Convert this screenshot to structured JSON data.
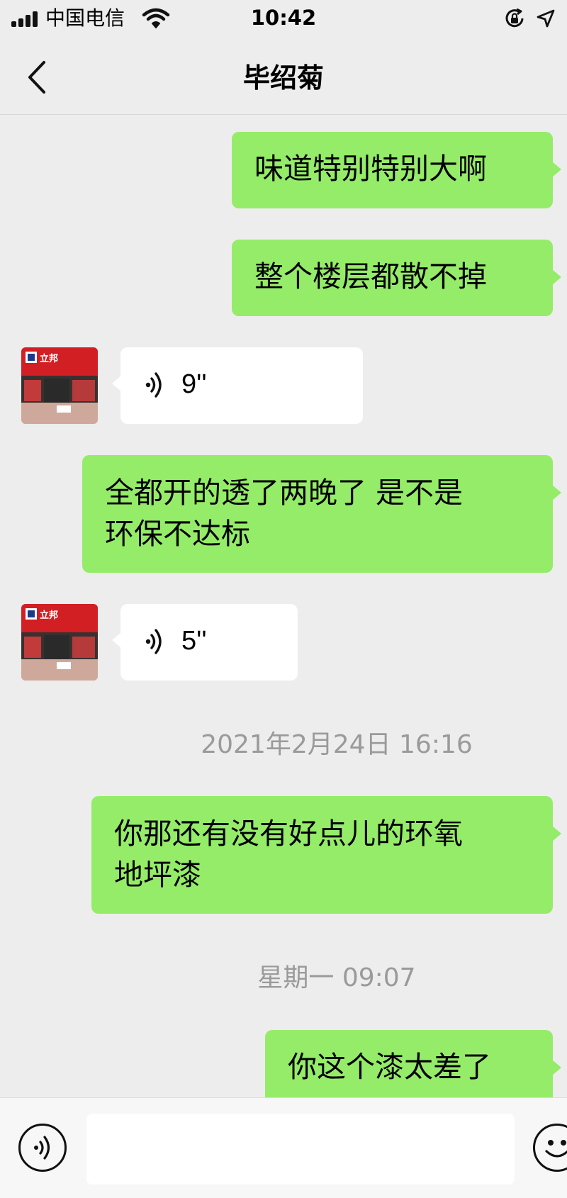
{
  "status_bar": {
    "carrier": "中国电信",
    "time": "10:42"
  },
  "header": {
    "title": "毕绍菊"
  },
  "messages": [
    {
      "direction": "out",
      "type": "text",
      "text": "味道特别特别大啊"
    },
    {
      "direction": "out",
      "type": "text",
      "text": "整个楼层都散不掉"
    },
    {
      "direction": "in",
      "type": "voice",
      "duration": "9''",
      "avatar_sign": "立邦"
    },
    {
      "direction": "out",
      "type": "text",
      "text": "全都开的透了两晚了 是不是\n环保不达标"
    },
    {
      "direction": "in",
      "type": "voice",
      "duration": "5''",
      "avatar_sign": "立邦"
    },
    {
      "type": "timestamp",
      "text": "2021年2月24日 16:16"
    },
    {
      "direction": "out",
      "type": "text",
      "text": "你那还有没有好点儿的环氧\n地坪漆"
    },
    {
      "type": "timestamp",
      "text": "星期一 09:07"
    },
    {
      "direction": "out",
      "type": "text",
      "text": "你这个漆太差了"
    }
  ],
  "input_bar": {
    "text_value": ""
  },
  "icons": {
    "back": "chevron-left-icon",
    "voice_message": "sound-wave-icon",
    "voice_input": "voice-input-icon",
    "emoji": "smiley-icon",
    "wifi": "wifi-icon",
    "location": "location-arrow-icon",
    "rotation_lock": "rotation-lock-icon"
  },
  "colors": {
    "outgoing_bubble": "#95ec69",
    "incoming_bubble": "#ffffff",
    "background": "#ededed",
    "timestamp_text": "#9a9a9a"
  }
}
